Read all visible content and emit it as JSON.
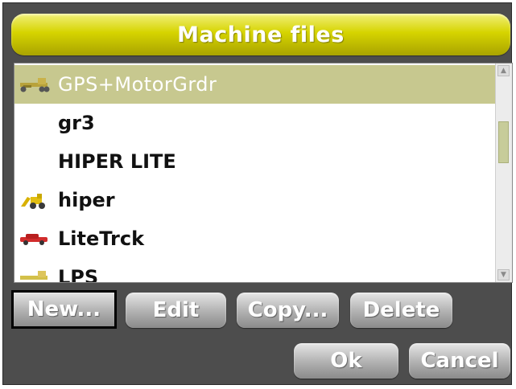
{
  "window": {
    "title": "Machine files"
  },
  "list": {
    "items": [
      {
        "label": "GPS+MotorGrdr",
        "icon": "motor-grader-icon",
        "selected": true
      },
      {
        "label": "gr3",
        "icon": "",
        "selected": false
      },
      {
        "label": "HIPER LITE",
        "icon": "",
        "selected": false
      },
      {
        "label": "hiper",
        "icon": "excavator-icon",
        "selected": false
      },
      {
        "label": "LiteTrck",
        "icon": "truck-icon",
        "selected": false
      },
      {
        "label": "LPS",
        "icon": "motor-grader-icon",
        "selected": false
      }
    ]
  },
  "buttons": {
    "new": "New...",
    "edit": "Edit",
    "copy": "Copy...",
    "delete": "Delete",
    "ok": "Ok",
    "cancel": "Cancel"
  },
  "colors": {
    "title_bar": "#d6d400",
    "selected_row": "#c7c88f",
    "frame_background": "#4d4d4d"
  }
}
